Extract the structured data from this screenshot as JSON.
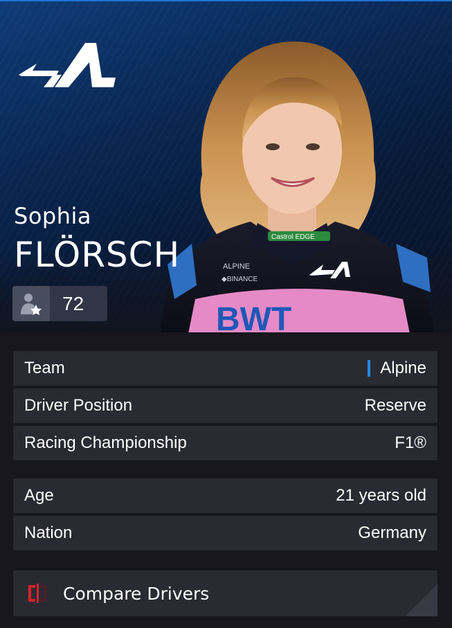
{
  "driver": {
    "first_name": "Sophia",
    "last_name": "FLÖRSCH",
    "rating": "72",
    "rating_icon": "driver-star-icon",
    "team_logo": "alpine-logo"
  },
  "details": [
    {
      "label": "Team",
      "value": "Alpine"
    },
    {
      "label": "Driver Position",
      "value": "Reserve"
    },
    {
      "label": "Racing Championship",
      "value": "F1®"
    }
  ],
  "personal": [
    {
      "label": "Age",
      "value": "21 years old"
    },
    {
      "label": "Nation",
      "value": "Germany"
    }
  ],
  "actions": {
    "compare_label": "Compare Drivers",
    "compare_icon": "compare-icon"
  },
  "colors": {
    "team_accent": "#1d8cf0",
    "compare_icon": "#d8232a",
    "panel": "#2a2a33"
  }
}
